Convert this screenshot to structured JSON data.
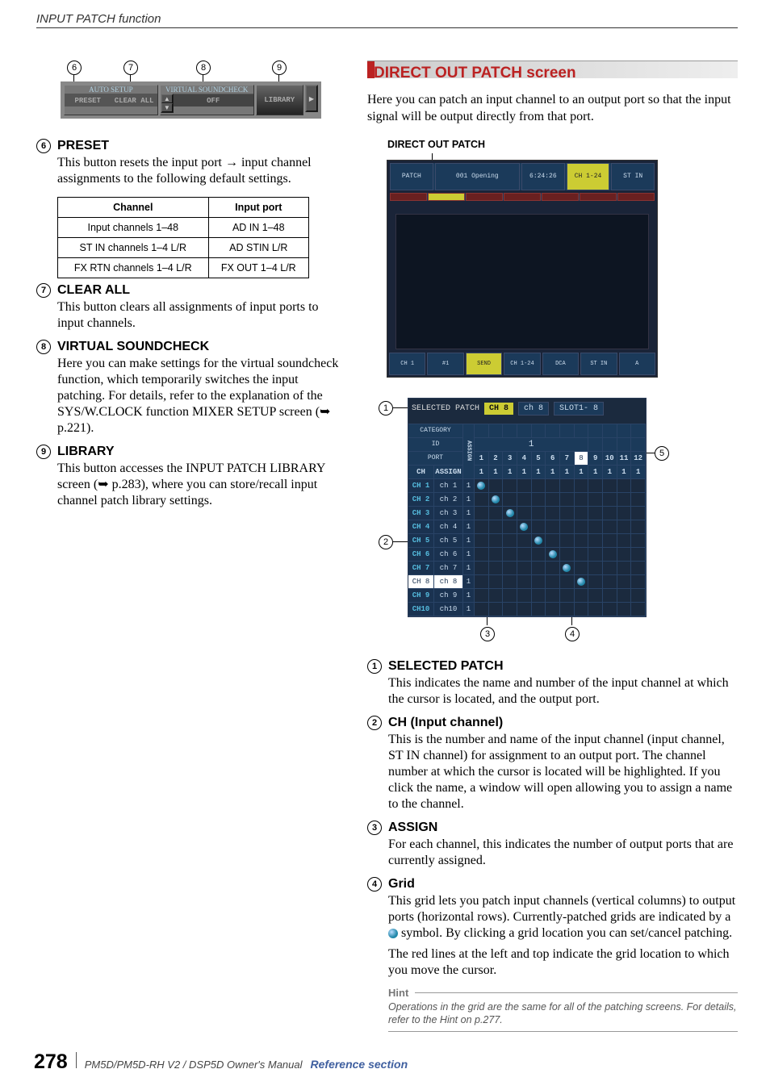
{
  "header": {
    "section": "INPUT PATCH function"
  },
  "buttonbar": {
    "markers": [
      "6",
      "7",
      "8",
      "9"
    ],
    "auto_setup": "AUTO SETUP",
    "preset": "PRESET",
    "clear_all": "CLEAR ALL",
    "virtual_sc": "VIRTUAL SOUNDCHECK",
    "off": "OFF",
    "library": "LIBRARY"
  },
  "left_defs": [
    {
      "num": "6",
      "title": "PRESET",
      "body": "This button resets the input port → input channel assignments to the following default settings."
    },
    {
      "num": "7",
      "title": "CLEAR ALL",
      "body": "This button clears all assignments of input ports to input channels."
    },
    {
      "num": "8",
      "title": "VIRTUAL SOUNDCHECK",
      "body": "Here you can make settings for the virtual soundcheck function, which temporarily switches the input patching. For details, refer to the explanation of the SYS/W.CLOCK function MIXER SETUP screen (➥ p.221)."
    },
    {
      "num": "9",
      "title": "LIBRARY",
      "body": "This button accesses the INPUT PATCH LIBRARY screen (➥ p.283), where you can store/recall input channel patch library settings."
    }
  ],
  "table": {
    "headers": [
      "Channel",
      "Input port"
    ],
    "rows": [
      [
        "Input channels 1–48",
        "AD IN 1–48"
      ],
      [
        "ST IN channels 1–4 L/R",
        "AD STIN L/R"
      ],
      [
        "FX RTN channels 1–4 L/R",
        "FX OUT 1–4 L/R"
      ]
    ]
  },
  "right": {
    "title": "DIRECT OUT PATCH screen",
    "intro": "Here you can patch an input channel to an output port so that the input signal will be output directly from that port.",
    "overview_label": "DIRECT OUT PATCH",
    "overview_top": {
      "patch": "PATCH",
      "scene": "001 Opening",
      "time": "6:24:26",
      "meter1": "CH 1-24",
      "meter2": "ST IN"
    },
    "overview_foot": [
      "CH 1",
      "#1",
      "SEND",
      "CH 1-24",
      "DCA",
      "ST IN",
      "A"
    ],
    "detail": {
      "sel_label": "SELECTED PATCH",
      "sel_ch": "CH 8",
      "sel_name": "ch 8",
      "sel_port": "SLOT1- 8",
      "hdr_category": "CATEGORY",
      "hdr_id": "ID",
      "hdr_port": "PORT",
      "hdr_ch": "CH",
      "hdr_assign": "ASSIGN",
      "big_id": "1",
      "col_port_row": [
        "1",
        "2",
        "3",
        "4",
        "5",
        "6",
        "7",
        "8",
        "9",
        "10",
        "11",
        "12"
      ],
      "rows": [
        {
          "ch": "CH 1",
          "name": "ch 1",
          "assign": "1",
          "patch": 0
        },
        {
          "ch": "CH 2",
          "name": "ch 2",
          "assign": "1",
          "patch": 1
        },
        {
          "ch": "CH 3",
          "name": "ch 3",
          "assign": "1",
          "patch": 2
        },
        {
          "ch": "CH 4",
          "name": "ch 4",
          "assign": "1",
          "patch": 3
        },
        {
          "ch": "CH 5",
          "name": "ch 5",
          "assign": "1",
          "patch": 4
        },
        {
          "ch": "CH 6",
          "name": "ch 6",
          "assign": "1",
          "patch": 5
        },
        {
          "ch": "CH 7",
          "name": "ch 7",
          "assign": "1",
          "patch": 6
        },
        {
          "ch": "CH 8",
          "name": "ch 8",
          "assign": "1",
          "patch": 7,
          "sel": true
        },
        {
          "ch": "CH 9",
          "name": "ch 9",
          "assign": "1",
          "patch": -1
        },
        {
          "ch": "CH10",
          "name": "ch10",
          "assign": "1",
          "patch": -1
        }
      ],
      "callouts": [
        "1",
        "2",
        "3",
        "4",
        "5"
      ]
    },
    "defs": [
      {
        "num": "1",
        "title": "SELECTED PATCH",
        "body": "This indicates the name and number of the input channel at which the cursor is located, and the output port."
      },
      {
        "num": "2",
        "title": "CH (Input channel)",
        "body": "This is the number and name of the input channel (input channel, ST IN channel) for assignment to an output port. The channel number at which the cursor is located will be highlighted. If you click the name, a window will open allowing you to assign a name to the channel."
      },
      {
        "num": "3",
        "title": "ASSIGN",
        "body": "For each channel, this indicates the number of output ports that are currently assigned."
      },
      {
        "num": "4",
        "title": "Grid",
        "body_pre": "This grid lets you patch input channels (vertical columns) to output ports (horizontal rows). Currently-patched grids are indicated by a ",
        "body_post": " symbol. By clicking a grid location you can set/cancel patching.",
        "body_extra": "The red lines at the left and top indicate the grid location to which you move the cursor."
      }
    ],
    "hint_label": "Hint",
    "hint_body": "Operations in the grid are the same for all of the patching screens. For details, refer to the Hint on p.277."
  },
  "footer": {
    "page": "278",
    "doc": "PM5D/PM5D-RH V2 / DSP5D Owner's Manual",
    "section": "Reference section"
  }
}
